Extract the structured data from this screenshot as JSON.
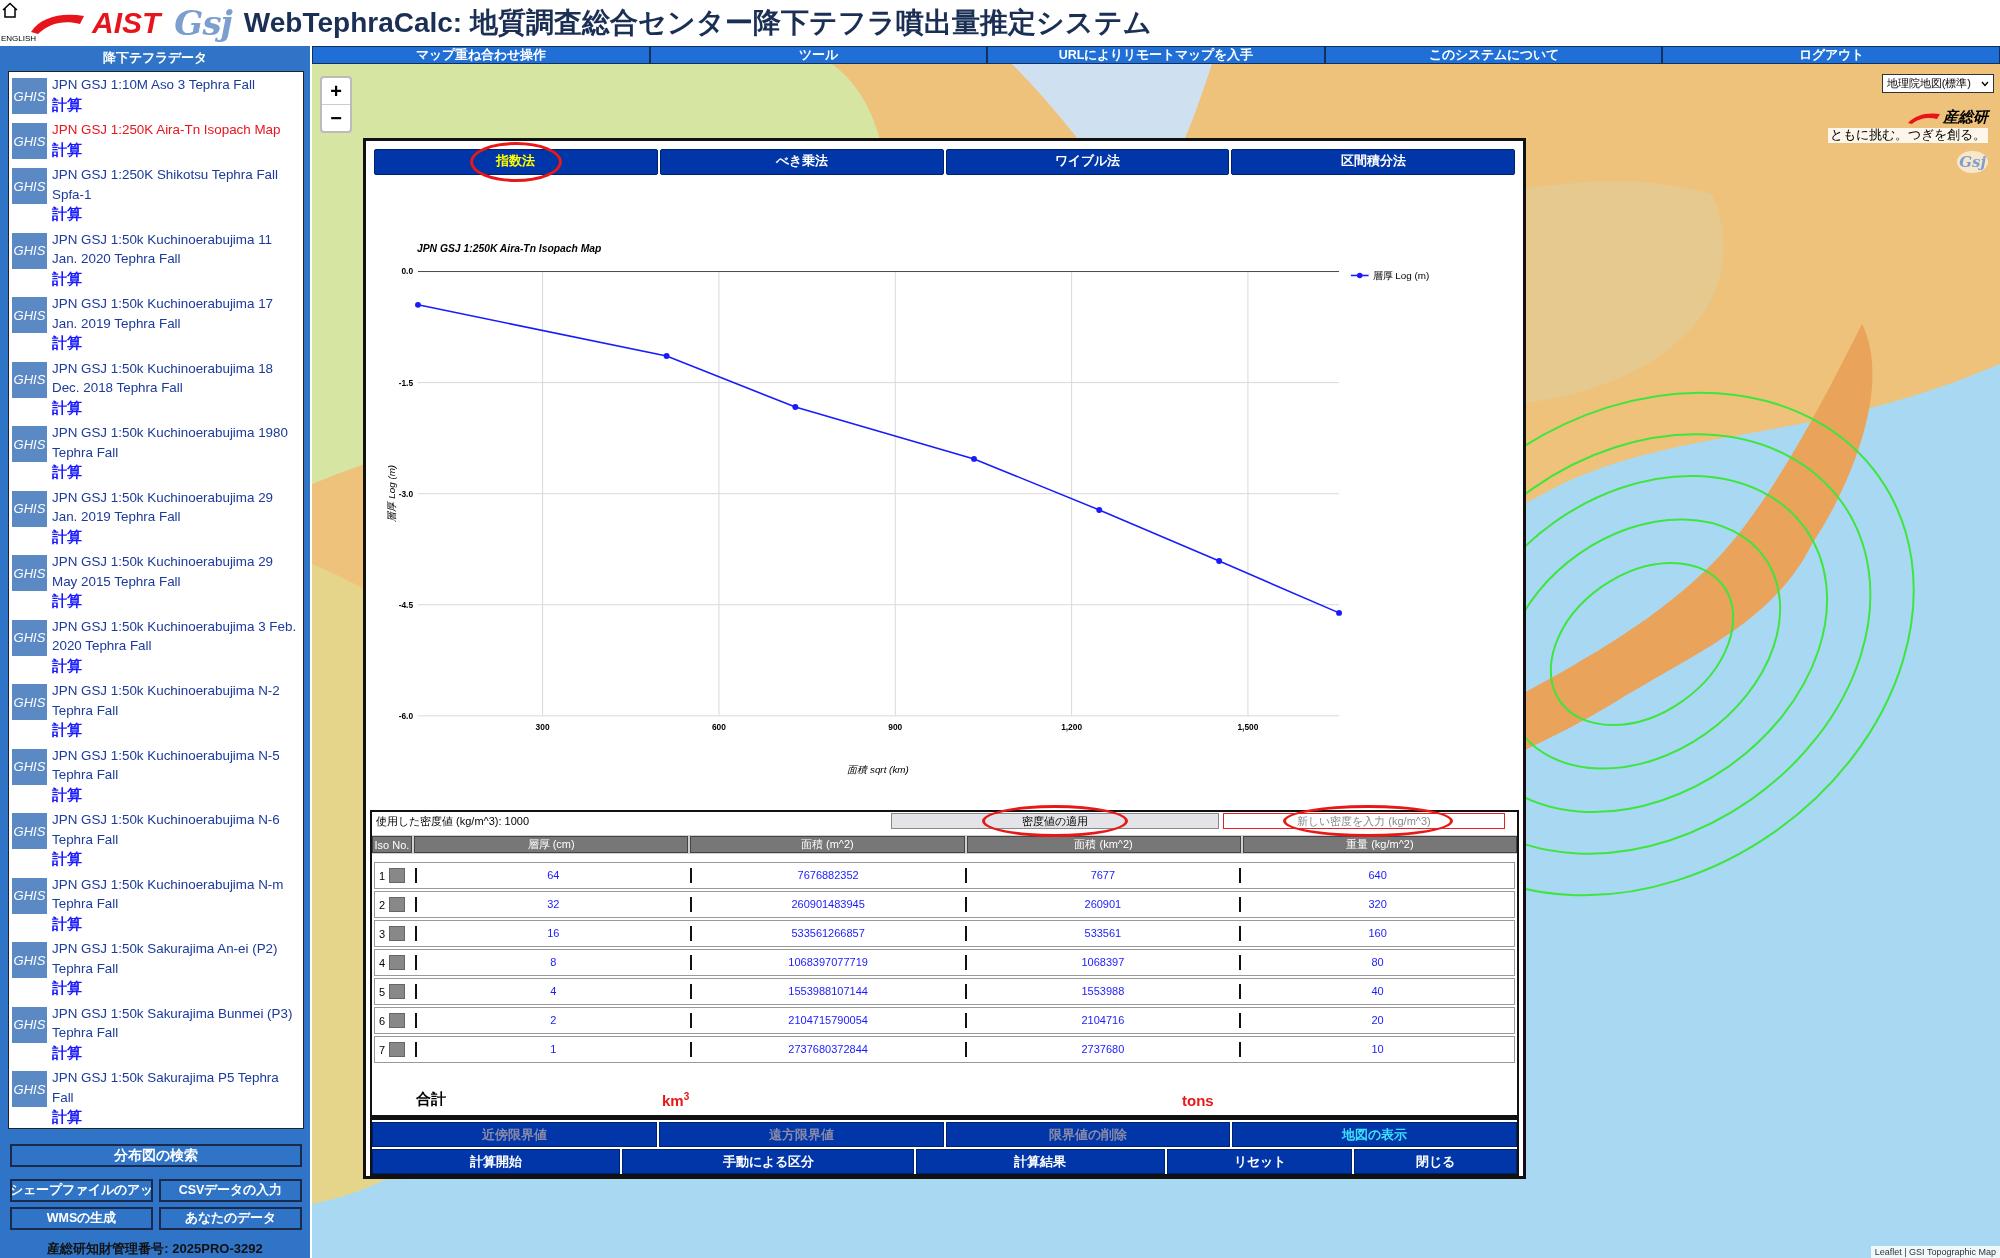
{
  "header": {
    "language_link": "ENGLISH",
    "aist_logo": "AIST",
    "gsj_logo": "Gsj",
    "title": "WebTephraCalc: 地質調査総合センター降下テフラ噴出量推定システム"
  },
  "sidebar": {
    "title": "降下テフラデータ",
    "items": [
      {
        "badge": "GHIS",
        "name": "JPN GSJ 1:10M Aso 3 Tephra Fall",
        "action": "計算",
        "selected": false
      },
      {
        "badge": "GHIS",
        "name": "JPN GSJ 1:250K Aira-Tn Isopach Map",
        "action": "計算",
        "selected": true
      },
      {
        "badge": "GHIS",
        "name": "JPN GSJ 1:250K Shikotsu Tephra Fall Spfa-1",
        "action": "計算",
        "selected": false
      },
      {
        "badge": "GHIS",
        "name": "JPN GSJ 1:50k Kuchinoerabujima 11 Jan. 2020 Tephra Fall",
        "action": "計算",
        "selected": false
      },
      {
        "badge": "GHIS",
        "name": "JPN GSJ 1:50k Kuchinoerabujima 17 Jan. 2019 Tephra Fall",
        "action": "計算",
        "selected": false
      },
      {
        "badge": "GHIS",
        "name": "JPN GSJ 1:50k Kuchinoerabujima 18 Dec. 2018 Tephra Fall",
        "action": "計算",
        "selected": false
      },
      {
        "badge": "GHIS",
        "name": "JPN GSJ 1:50k Kuchinoerabujima 1980 Tephra Fall",
        "action": "計算",
        "selected": false
      },
      {
        "badge": "GHIS",
        "name": "JPN GSJ 1:50k Kuchinoerabujima 29 Jan. 2019 Tephra Fall",
        "action": "計算",
        "selected": false
      },
      {
        "badge": "GHIS",
        "name": "JPN GSJ 1:50k Kuchinoerabujima 29 May 2015 Tephra Fall",
        "action": "計算",
        "selected": false
      },
      {
        "badge": "GHIS",
        "name": "JPN GSJ 1:50k Kuchinoerabujima 3 Feb. 2020 Tephra Fall",
        "action": "計算",
        "selected": false
      },
      {
        "badge": "GHIS",
        "name": "JPN GSJ 1:50k Kuchinoerabujima N-2 Tephra Fall",
        "action": "計算",
        "selected": false
      },
      {
        "badge": "GHIS",
        "name": "JPN GSJ 1:50k Kuchinoerabujima N-5 Tephra Fall",
        "action": "計算",
        "selected": false
      },
      {
        "badge": "GHIS",
        "name": "JPN GSJ 1:50k Kuchinoerabujima N-6 Tephra Fall",
        "action": "計算",
        "selected": false
      },
      {
        "badge": "GHIS",
        "name": "JPN GSJ 1:50k Kuchinoerabujima N-m Tephra Fall",
        "action": "計算",
        "selected": false
      },
      {
        "badge": "GHIS",
        "name": "JPN GSJ 1:50k Sakurajima An-ei (P2) Tephra Fall",
        "action": "計算",
        "selected": false
      },
      {
        "badge": "GHIS",
        "name": "JPN GSJ 1:50k Sakurajima Bunmei (P3) Tephra Fall",
        "action": "計算",
        "selected": false
      },
      {
        "badge": "GHIS",
        "name": "JPN GSJ 1:50k Sakurajima P5 Tephra Fall",
        "action": "計算",
        "selected": false
      }
    ],
    "search_button": "分布図の検索",
    "buttons": [
      "シェープファイルのアッ",
      "CSVデータの入力",
      "WMSの生成",
      "あなたのデータ"
    ],
    "footer": "産総研知財管理番号: 2025PRO-3292"
  },
  "nav": {
    "items": [
      "マップ重ね合わせ操作",
      "ツール",
      "URLによりリモートマップを入手",
      "このシステムについて",
      "ログアウト"
    ]
  },
  "map": {
    "zoom_in": "+",
    "zoom_out": "−",
    "layer_select": "地理院地図(標準)",
    "logo": "産総研",
    "tagline": "ともに挑む。つぎを創る。",
    "gsj_logo": "Gsj",
    "attribution": "Leaflet | GSI Topographic Map"
  },
  "dialog": {
    "tabs": [
      {
        "label": "指数法",
        "selected": true,
        "highlighted": true
      },
      {
        "label": "べき乗法",
        "selected": false,
        "highlighted": false
      },
      {
        "label": "ワイブル法",
        "selected": false,
        "highlighted": false
      },
      {
        "label": "区間積分法",
        "selected": false,
        "highlighted": false
      }
    ],
    "chart_data": {
      "type": "line",
      "title": "JPN GSJ 1:250K Aira-Tn Isopach Map",
      "xlabel": "面積 sqrt (km)",
      "ylabel": "層厚 Log (m)",
      "x": [
        88,
        511,
        730,
        1034,
        1247,
        1451,
        1655
      ],
      "grid": true,
      "series": [
        {
          "name": "層厚 Log (m)",
          "color": "#1a1aff",
          "marker": "circle",
          "values": [
            -0.45,
            -1.14,
            -1.83,
            -2.53,
            -3.22,
            -3.91,
            -4.61
          ]
        }
      ],
      "xlim": [
        88,
        1655
      ],
      "ylim": [
        -6,
        0
      ],
      "xticks": [
        {
          "value": 300,
          "label": "300"
        },
        {
          "value": 600,
          "label": "600"
        },
        {
          "value": 900,
          "label": "900"
        },
        {
          "value": 1200,
          "label": "1,200"
        },
        {
          "value": 1500,
          "label": "1,500"
        }
      ],
      "yticks": [
        {
          "value": 0,
          "label": "0.0"
        },
        {
          "value": -1.5,
          "label": "-1.5"
        },
        {
          "value": -3,
          "label": "-3.0"
        },
        {
          "value": -4.5,
          "label": "-4.5"
        },
        {
          "value": -6,
          "label": "-6.0"
        }
      ]
    },
    "density": {
      "label": "使用した密度値 (kg/m^3): 1000",
      "apply_button": {
        "label": "密度値の適用",
        "highlighted": true
      },
      "input": {
        "placeholder": "新しい密度を入力 (kg/m^3)",
        "highlighted": true
      }
    },
    "table": {
      "columns": [
        "Iso No.",
        "層厚 (cm)",
        "面積 (m^2)",
        "面積 (km^2)",
        "重量 (kg/m^2)"
      ],
      "rows": [
        {
          "iso": "1",
          "thickness": "64",
          "area_m2": "7676882352",
          "area_km2": "7677",
          "weight": "640"
        },
        {
          "iso": "2",
          "thickness": "32",
          "area_m2": "260901483945",
          "area_km2": "260901",
          "weight": "320"
        },
        {
          "iso": "3",
          "thickness": "16",
          "area_m2": "533561266857",
          "area_km2": "533561",
          "weight": "160"
        },
        {
          "iso": "4",
          "thickness": "8",
          "area_m2": "1068397077719",
          "area_km2": "1068397",
          "weight": "80"
        },
        {
          "iso": "5",
          "thickness": "4",
          "area_m2": "1553988107144",
          "area_km2": "1553988",
          "weight": "40"
        },
        {
          "iso": "6",
          "thickness": "2",
          "area_m2": "2104715790054",
          "area_km2": "2104716",
          "weight": "20"
        },
        {
          "iso": "7",
          "thickness": "1",
          "area_m2": "2737680372844",
          "area_km2": "2737680",
          "weight": "10"
        }
      ],
      "total": {
        "label": "合計",
        "volume": "km$^{3}$",
        "mass": "tons"
      }
    },
    "tool_buttons": [
      {
        "label": "近傍限界値",
        "disabled": true
      },
      {
        "label": "遠方限界値",
        "disabled": true
      },
      {
        "label": "限界値の削除",
        "disabled": true
      },
      {
        "label": "地図の表示",
        "disabled": false
      }
    ],
    "action_buttons": [
      "計算開始",
      "手動による区分",
      "計算結果",
      "リセット",
      "閉じる"
    ]
  }
}
